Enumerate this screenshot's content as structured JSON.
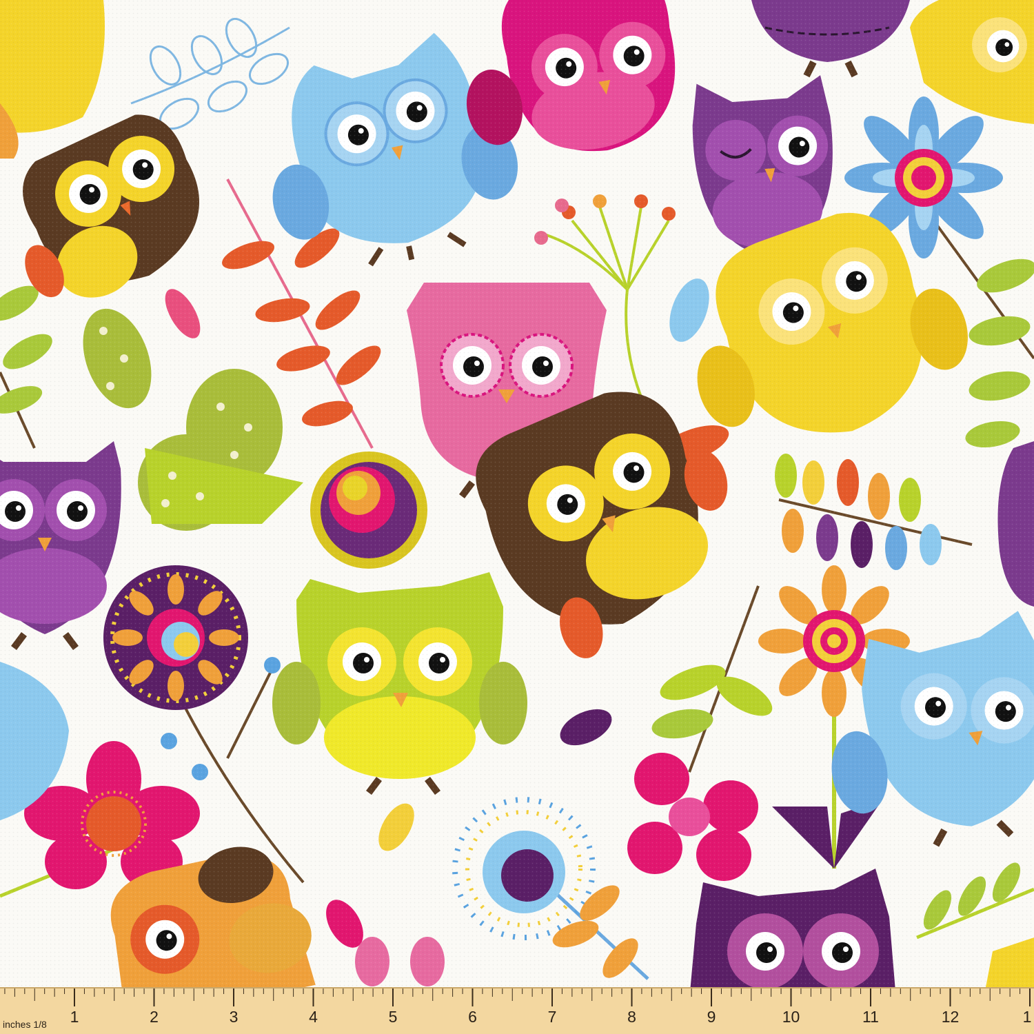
{
  "ruler": {
    "unit_label": "inches 1/8",
    "numbers": [
      "1",
      "2",
      "3",
      "4",
      "5",
      "6",
      "7",
      "8",
      "9",
      "10",
      "11",
      "12",
      "1"
    ]
  },
  "palette": {
    "background": "#fbfaf6",
    "pink": "#e94f9b",
    "magenta": "#d9147e",
    "sky": "#8cc9ee",
    "purple": "#7b3a8d",
    "brown": "#5a3a22",
    "yellow": "#f4d42a",
    "lime": "#b8d22b",
    "orange": "#ec6a2c",
    "ruler": "#f3d7a0"
  },
  "owls": [
    {
      "name": "owl-brown-topleft",
      "body": "brown",
      "face": "yellow"
    },
    {
      "name": "owl-blue-top",
      "body": "sky",
      "face": "sky"
    },
    {
      "name": "owl-pink-top",
      "body": "magenta",
      "face": "pink"
    },
    {
      "name": "owl-purple-topright",
      "body": "purple",
      "face": "purple"
    },
    {
      "name": "owl-pink-center",
      "body": "pink",
      "face": "pink"
    },
    {
      "name": "owl-yellow-right",
      "body": "yellow",
      "face": "yellow"
    },
    {
      "name": "owl-purple-left",
      "body": "purple",
      "face": "purple"
    },
    {
      "name": "owl-brown-center",
      "body": "brown",
      "face": "yellow"
    },
    {
      "name": "owl-lime-center",
      "body": "lime",
      "face": "yellow"
    },
    {
      "name": "owl-blue-right",
      "body": "sky",
      "face": "sky"
    },
    {
      "name": "owl-orange-bottom",
      "body": "orange",
      "face": "orange"
    },
    {
      "name": "owl-purple-bottom",
      "body": "purple",
      "face": "pink"
    }
  ]
}
